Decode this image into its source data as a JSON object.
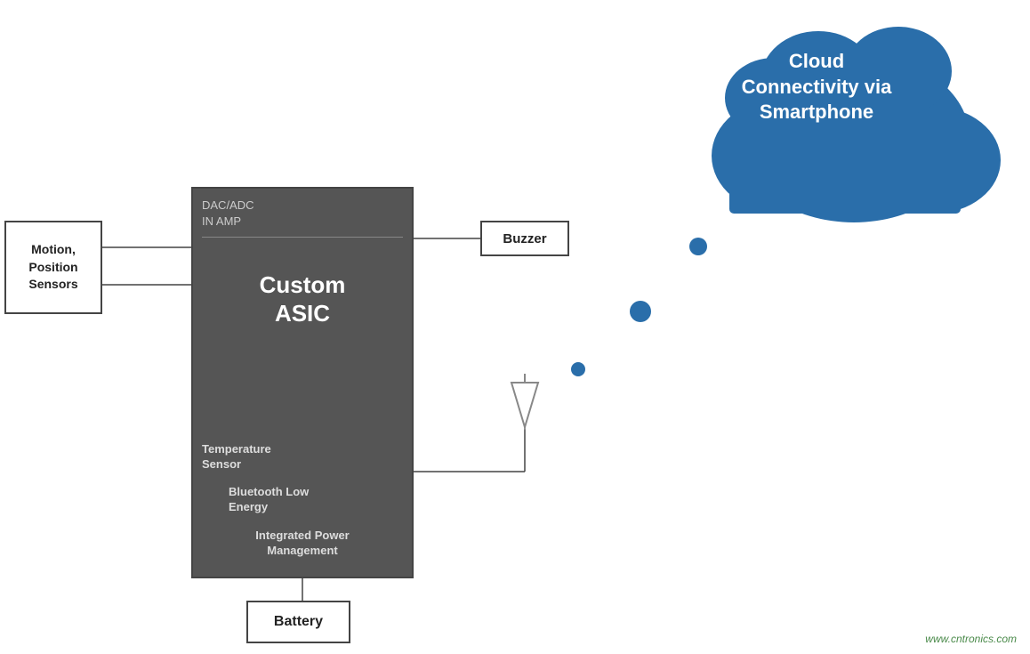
{
  "cloud": {
    "text_line1": "Cloud",
    "text_line2": "Connectivity via",
    "text_line3": "Smartphone"
  },
  "asic": {
    "top_label_line1": "DAC/ADC",
    "top_label_line2": "IN AMP",
    "title_line1": "Custom",
    "title_line2": "ASIC",
    "temp_label_line1": "Temperature",
    "temp_label_line2": "Sensor",
    "ble_label_line1": "Bluetooth Low",
    "ble_label_line2": "Energy",
    "power_label_line1": "Integrated Power",
    "power_label_line2": "Management"
  },
  "sensors": {
    "label_line1": "Motion,",
    "label_line2": "Position",
    "label_line3": "Sensors"
  },
  "buzzer": {
    "label": "Buzzer"
  },
  "battery": {
    "label": "Battery"
  },
  "website": {
    "url": "www.cntronics.com"
  },
  "colors": {
    "cloud_bg": "#2a6eaa",
    "asic_bg": "#555555",
    "box_border": "#444444",
    "dot_color": "#2a6eaa",
    "line_color": "#444444",
    "text_white": "#ffffff",
    "text_dark": "#222222"
  }
}
